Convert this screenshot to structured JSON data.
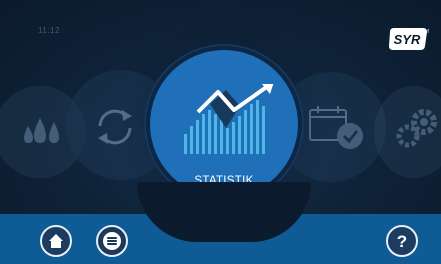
{
  "status": {
    "time": "11:12"
  },
  "brand": {
    "logo_text": "SYR",
    "registered": "®"
  },
  "carousel": {
    "items": [
      {
        "name": "wasser",
        "icon": "water-drops-icon"
      },
      {
        "name": "regeneration",
        "icon": "refresh-icon"
      },
      {
        "name": "statistik",
        "icon": "statistics-chart-icon",
        "label": "STATISTIK"
      },
      {
        "name": "kalender",
        "icon": "calendar-check-icon"
      },
      {
        "name": "einstellungen",
        "icon": "gears-icon"
      }
    ],
    "active_index": 2
  },
  "footer": {
    "home_icon": "home-icon",
    "menu_icon": "menu-icon",
    "help_label": "?"
  },
  "colors": {
    "background": "#0b1a2c",
    "accent": "#1f6fb9",
    "footer": "#0f5b96",
    "chart_bars": "#4fb6e6"
  }
}
